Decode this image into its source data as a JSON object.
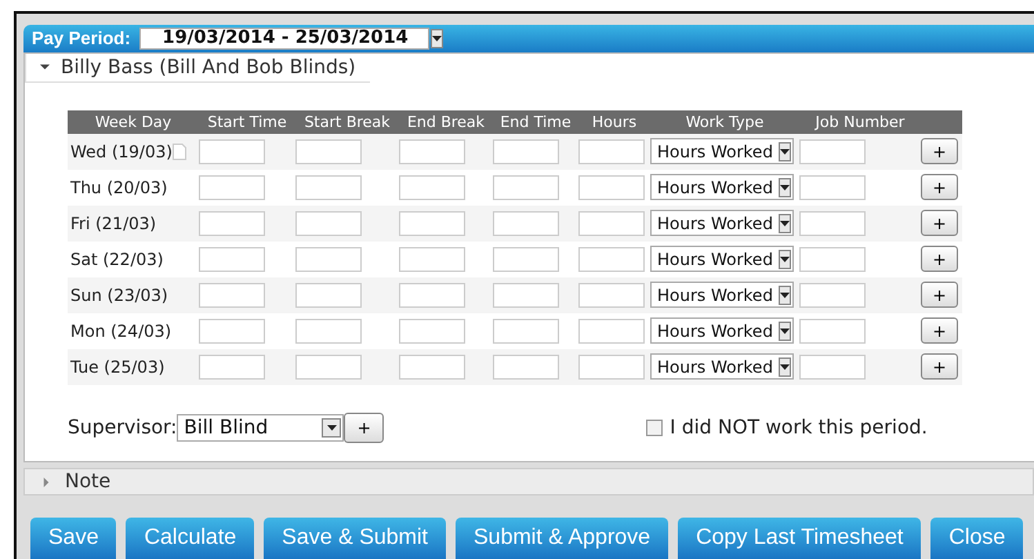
{
  "pay_period": {
    "label": "Pay Period:",
    "value": "19/03/2014 - 25/03/2014"
  },
  "employee_section": {
    "title": "Billy Bass (Bill And Bob Blinds)",
    "expanded": true
  },
  "table": {
    "columns": [
      "Week Day",
      "Start Time",
      "Start Break",
      "End Break",
      "End Time",
      "Hours",
      "Work Type",
      "Job Number"
    ],
    "rows": [
      {
        "day": "Wed (19/03)",
        "has_note": true,
        "work_type": "Hours Worked",
        "add": "+"
      },
      {
        "day": "Thu (20/03)",
        "has_note": false,
        "work_type": "Hours Worked",
        "add": "+"
      },
      {
        "day": "Fri (21/03)",
        "has_note": false,
        "work_type": "Hours Worked",
        "add": "+"
      },
      {
        "day": "Sat (22/03)",
        "has_note": false,
        "work_type": "Hours Worked",
        "add": "+"
      },
      {
        "day": "Sun (23/03)",
        "has_note": false,
        "work_type": "Hours Worked",
        "add": "+"
      },
      {
        "day": "Mon (24/03)",
        "has_note": false,
        "work_type": "Hours Worked",
        "add": "+"
      },
      {
        "day": "Tue (25/03)",
        "has_note": false,
        "work_type": "Hours Worked",
        "add": "+"
      }
    ]
  },
  "supervisor": {
    "label": "Supervisor:",
    "value": "Bill Blind",
    "add": "+"
  },
  "not_worked": {
    "label": "I did NOT work this period.",
    "checked": false
  },
  "note_section": {
    "title": "Note",
    "expanded": false
  },
  "buttons": [
    "Save",
    "Calculate",
    "Save & Submit",
    "Submit & Approve",
    "Copy Last Timesheet",
    "Close"
  ]
}
